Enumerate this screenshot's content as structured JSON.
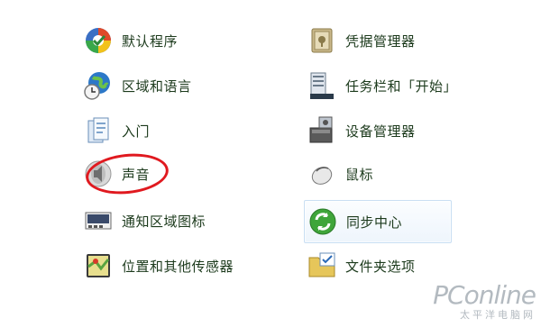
{
  "left_column": [
    {
      "label": "默认程序",
      "icon": "default-programs-icon"
    },
    {
      "label": "区域和语言",
      "icon": "region-language-icon"
    },
    {
      "label": "入门",
      "icon": "getting-started-icon"
    },
    {
      "label": "声音",
      "icon": "sound-icon"
    },
    {
      "label": "通知区域图标",
      "icon": "notification-area-icon"
    },
    {
      "label": "位置和其他传感器",
      "icon": "location-sensors-icon"
    }
  ],
  "right_column": [
    {
      "label": "凭据管理器",
      "icon": "credential-manager-icon"
    },
    {
      "label": "任务栏和「开始」",
      "icon": "taskbar-start-icon"
    },
    {
      "label": "设备管理器",
      "icon": "device-manager-icon"
    },
    {
      "label": "鼠标",
      "icon": "mouse-icon"
    },
    {
      "label": "同步中心",
      "icon": "sync-center-icon"
    },
    {
      "label": "文件夹选项",
      "icon": "folder-options-icon"
    }
  ],
  "highlight": {
    "target": "声音",
    "color": "#e0191f"
  },
  "watermark": {
    "logo": "PConline",
    "sub": "太平洋电脑网"
  },
  "colors": {
    "label": "#1c3a1c",
    "hover_border": "#c9dff3"
  }
}
